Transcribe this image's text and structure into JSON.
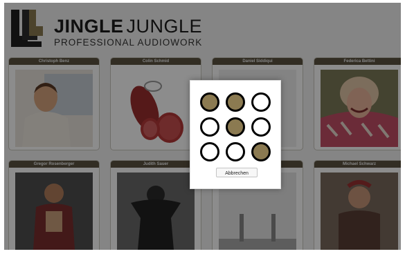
{
  "brand": {
    "name_bold": "JINGLE",
    "name_regular": "JUNGLE",
    "subtitle": "PROFESSIONAL AUDIOWORK"
  },
  "cards": [
    {
      "title": "Christoph Benz"
    },
    {
      "title": "Colin Schmid"
    },
    {
      "title": "Daniel Siddiqui"
    },
    {
      "title": "Federica Bettini"
    },
    {
      "title": "Gregor Rosenberger"
    },
    {
      "title": "Judith Sauer"
    },
    {
      "title": ""
    },
    {
      "title": "Michael Schwarz"
    }
  ],
  "unlock_dialog": {
    "pattern": [
      true,
      true,
      false,
      false,
      true,
      false,
      false,
      false,
      true
    ],
    "cancel_label": "Abbrechen"
  },
  "colors": {
    "accent": "#8b7a51",
    "card_header": "#5b5340"
  }
}
